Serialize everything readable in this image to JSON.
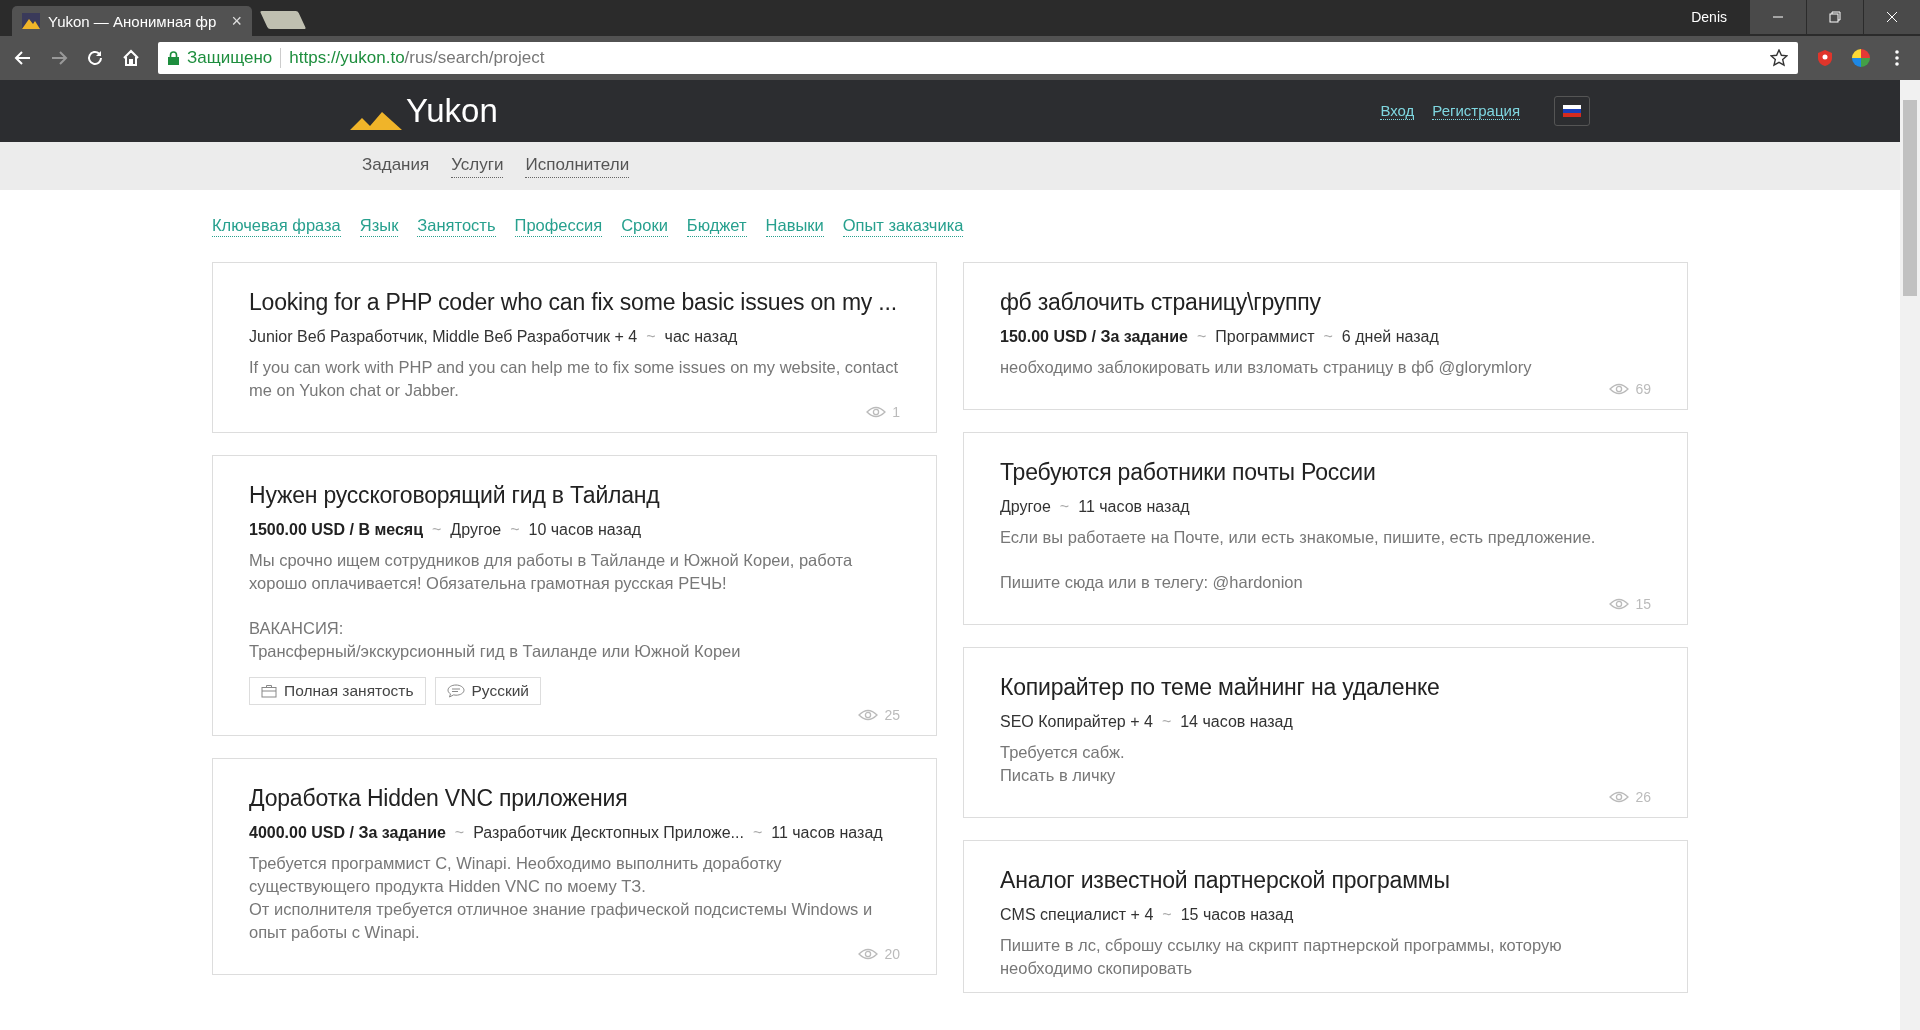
{
  "browser": {
    "tab_title": "Yukon — Анонимная фр",
    "tab_close": "×",
    "user": "Denis",
    "security": "Защищено",
    "url_host": "https://yukon.to",
    "url_path": "/rus/search/project"
  },
  "header": {
    "logo": "Yukon",
    "links": [
      {
        "label": "Вход"
      },
      {
        "label": "Регистрация"
      }
    ]
  },
  "nav": [
    {
      "label": "Задания",
      "selected": true
    },
    {
      "label": "Услуги",
      "selected": false
    },
    {
      "label": "Исполнители",
      "selected": false
    }
  ],
  "meta_separator": "~",
  "filters": [
    "Ключевая фраза",
    "Язык",
    "Занятость",
    "Профессия",
    "Сроки",
    "Бюджет",
    "Навыки",
    "Опыт заказчика"
  ],
  "columns": [
    {
      "cards": [
        {
          "title": "Looking for a PHP coder who can fix some basic issues on my ...",
          "meta": [
            {
              "kind": "text",
              "text": "Junior Веб Разработчик, Middle Веб Разработчик + 4"
            },
            {
              "kind": "text",
              "text": "час назад"
            }
          ],
          "body": [
            "If you can work with PHP and you can help me to fix some issues on my website, contact me on Yukon chat or Jabber."
          ],
          "views": "1"
        },
        {
          "title": "Нужен русскоговорящий гид в Тайланд",
          "meta": [
            {
              "kind": "price",
              "text": "1500.00 USD / В месяц"
            },
            {
              "kind": "text",
              "text": "Другое"
            },
            {
              "kind": "text",
              "text": "10 часов назад"
            }
          ],
          "body": [
            "Мы срочно ищем сотрудников для работы в Тайланде и Южной Кореи, работа хорошо оплачивается! Обязательна грамотная русская РЕЧЬ!",
            "ВАКАНСИЯ:\nТрансферный/экскурсионный гид в Таиланде или Южной Кореи"
          ],
          "tags": [
            {
              "kind": "employment",
              "text": "Полная занятость"
            },
            {
              "kind": "language",
              "text": "Русский"
            }
          ],
          "views": "25"
        },
        {
          "title": "Доработка Hidden VNC приложения",
          "meta": [
            {
              "kind": "price",
              "text": "4000.00 USD / За задание"
            },
            {
              "kind": "text",
              "text": "Разработчик Десктопных Приложе..."
            },
            {
              "kind": "text",
              "text": "11 часов назад"
            }
          ],
          "body": [
            "Требуется программист C, Winapi. Необходимо выполнить доработку существующего продукта Hidden VNC по моему ТЗ.\nОт исполнителя требуется отличное знание графической подсистемы Windows и опыт работы с Winapi."
          ],
          "views": "20"
        }
      ]
    },
    {
      "cards": [
        {
          "title": "фб заблочить страницу\\группу",
          "meta": [
            {
              "kind": "price",
              "text": "150.00 USD / За задание"
            },
            {
              "kind": "text",
              "text": "Программист"
            },
            {
              "kind": "text",
              "text": "6 дней назад"
            }
          ],
          "body": [
            "необходимо заблокировать или взломать страницу в фб @glorymlory"
          ],
          "views": "69"
        },
        {
          "title": "Требуются работники почты России",
          "meta": [
            {
              "kind": "text",
              "text": "Другое"
            },
            {
              "kind": "text",
              "text": "11 часов назад"
            }
          ],
          "body": [
            "Если вы работаете на Почте, или есть знакомые, пишите, есть предложение.",
            "Пишите сюда или в телегу: @hardonion"
          ],
          "views": "15"
        },
        {
          "title": "Копирайтер по теме майнинг на удаленке",
          "meta": [
            {
              "kind": "text",
              "text": "SEO Копирайтер + 4"
            },
            {
              "kind": "text",
              "text": "14 часов назад"
            }
          ],
          "body": [
            "Требуется сабж.\nПисать в личку"
          ],
          "views": "26"
        },
        {
          "title": "Аналог известной партнерской программы",
          "meta": [
            {
              "kind": "text",
              "text": "CMS специалист + 4"
            },
            {
              "kind": "text",
              "text": "15 часов назад"
            }
          ],
          "body": [
            "Пишите в лс, сброшу ссылку на скрипт партнерской программы, которую необходимо скопировать"
          ]
        }
      ]
    }
  ]
}
